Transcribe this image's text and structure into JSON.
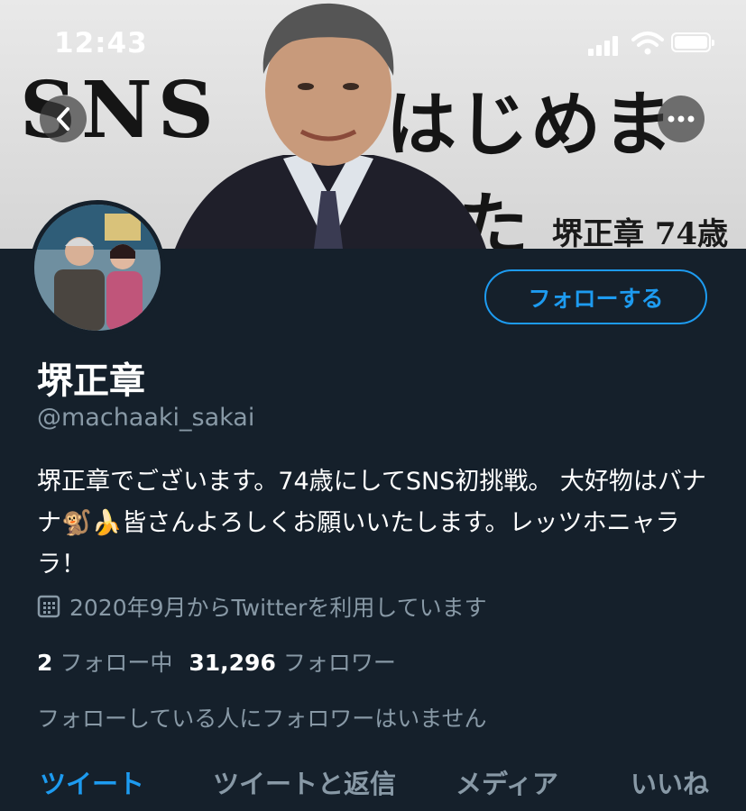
{
  "status_bar": {
    "time": "12:43"
  },
  "banner": {
    "title_left": "SNS",
    "title_right": "はじめました",
    "subtitle": "堺正章 74歳"
  },
  "profile": {
    "display_name": "堺正章",
    "handle": "@machaaki_sakai",
    "bio": "堺正章でございます。74歳にしてSNS初挑戦。 大好物はバナナ🐒🍌皆さんよろしくお願いいたします。レッツホニャララ！",
    "joined": "2020年9月からTwitterを利用しています",
    "following_count": "2",
    "following_label": "フォロー中",
    "followers_count": "31,296",
    "followers_label": "フォロワー",
    "followers_you_know": "フォローしている人にフォロワーはいません"
  },
  "actions": {
    "follow_label": "フォローする"
  },
  "tabs": [
    {
      "label": "ツイート",
      "active": true
    },
    {
      "label": "ツイートと返信",
      "active": false
    },
    {
      "label": "メディア",
      "active": false
    },
    {
      "label": "いいね",
      "active": false
    }
  ],
  "colors": {
    "background": "#15202b",
    "accent": "#1d9bf0",
    "secondary_text": "#8899a6"
  },
  "icons": [
    "back-arrow-icon",
    "more-icon",
    "calendar-icon",
    "signal-icon",
    "wifi-icon",
    "battery-icon"
  ]
}
